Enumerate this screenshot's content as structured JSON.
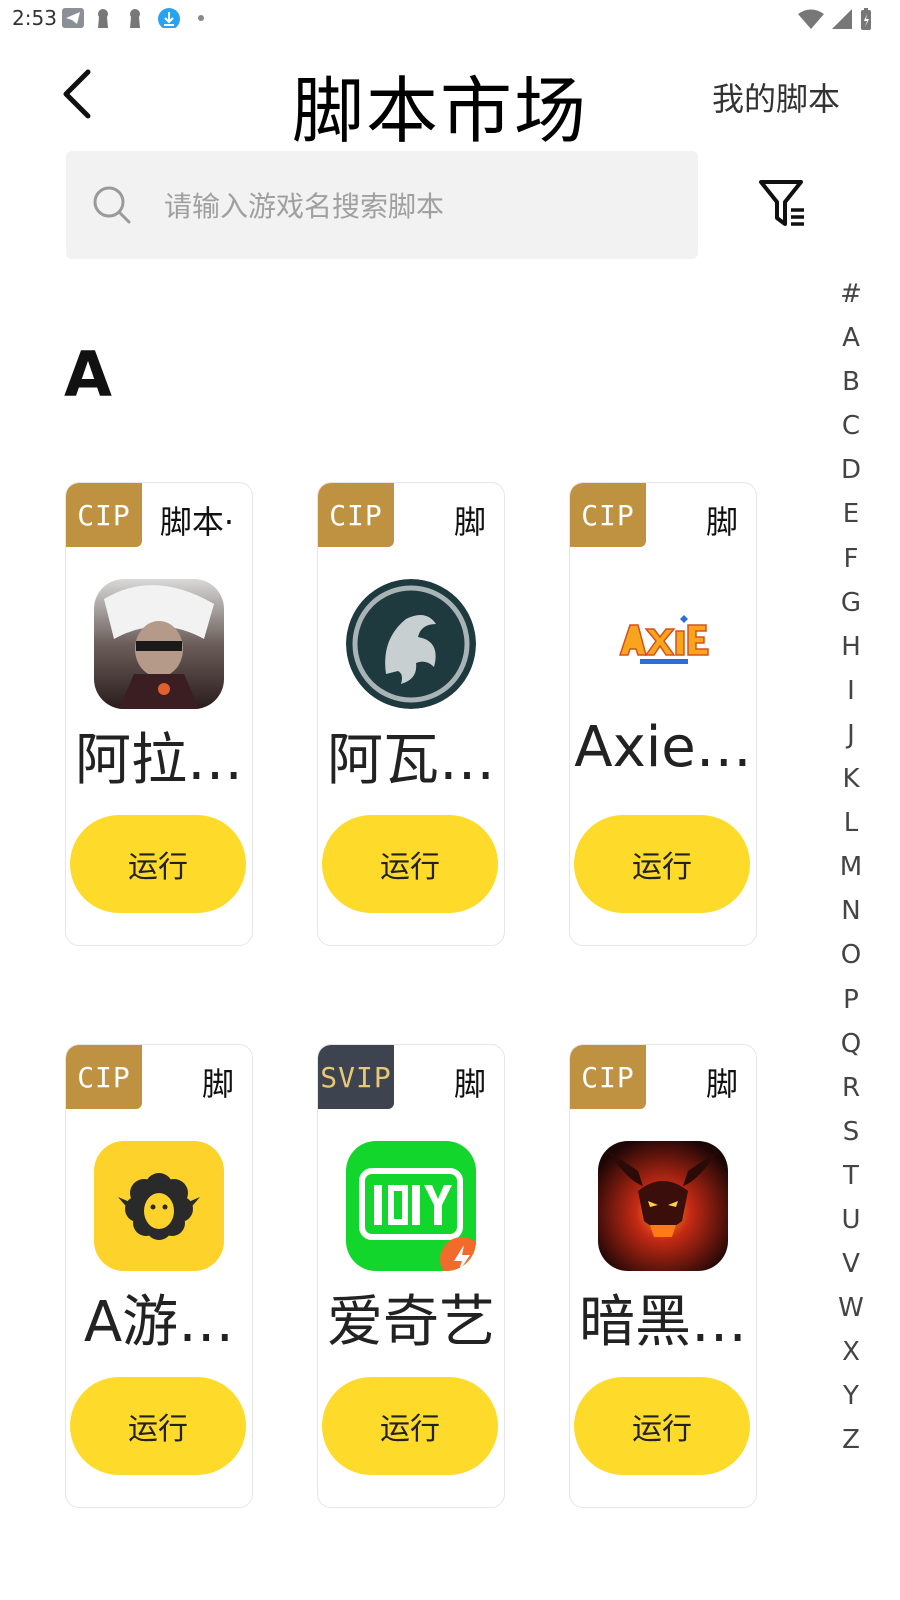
{
  "status_bar": {
    "time": "2:53"
  },
  "header": {
    "title": "脚本市场",
    "my_scripts": "我的脚本"
  },
  "search": {
    "placeholder": "请输入游戏名搜索脚本"
  },
  "section": {
    "letter": "A"
  },
  "index_letters": [
    "#",
    "A",
    "B",
    "C",
    "D",
    "E",
    "F",
    "G",
    "H",
    "I",
    "J",
    "K",
    "L",
    "M",
    "N",
    "O",
    "P",
    "Q",
    "R",
    "S",
    "T",
    "U",
    "V",
    "W",
    "X",
    "Y",
    "Z"
  ],
  "cards": [
    {
      "badge": "CIP",
      "tag": "脚本·",
      "name": "阿拉…",
      "run_label": "运行",
      "icon": "dark-warrior-game-icon"
    },
    {
      "badge": "CIP",
      "tag": "脚",
      "name": "阿瓦…",
      "run_label": "运行",
      "icon": "dragon-emblem-game-icon"
    },
    {
      "badge": "CIP",
      "tag": "脚",
      "name": "Axie…",
      "run_label": "运行",
      "icon": "axie-infinity-logo-icon"
    },
    {
      "badge": "CIP",
      "tag": "脚",
      "name": "A游…",
      "run_label": "运行",
      "icon": "sheep-app-icon"
    },
    {
      "badge": "SVIP",
      "tag": "脚",
      "name": "爱奇艺",
      "run_label": "运行",
      "icon": "iqiyi-app-icon"
    },
    {
      "badge": "CIP",
      "tag": "脚",
      "name": "暗黑…",
      "run_label": "运行",
      "icon": "diablo-demon-game-icon"
    }
  ],
  "colors": {
    "accent_button": "#fedb2a",
    "badge_cip": "#bf9241",
    "badge_svip": "#3e4350",
    "search_bg": "#f2f2f2"
  }
}
